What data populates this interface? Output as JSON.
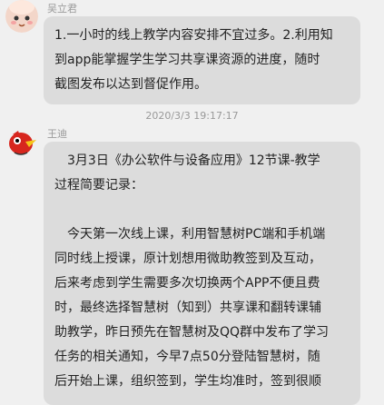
{
  "messages": [
    {
      "sender": "吴立君",
      "avatar_icon": "cartoon-face-avatar",
      "lines": [
        "1.一小时的线上教学内容安排不宜过多。2.利用知",
        "到app能掌握学生学习共享课资源的进度，随时",
        "截图发布以达到督促作用。"
      ]
    },
    {
      "timestamp": "2020/3/3 19:17:17",
      "sender": "王迪",
      "avatar_icon": "red-bird-avatar",
      "lines": [
        "　3月3日《办公软件与设备应用》12节课-教学",
        "过程简要记录：",
        "",
        "　今天第一次线上课，利用智慧树PC端和手机端",
        "同时线上授课，原计划想用微助教签到及互动，",
        "后来考虑到学生需要多次切换两个APP不便且费",
        "时，最终选择智慧树（知到）共享课和翻转课辅",
        "助教学，昨日预先在智慧树及QQ群中发布了学习",
        "任务的相关通知，今早7点50分登陆智慧树，随",
        "后开始上课，组织签到，学生均准时，签到很顺"
      ]
    }
  ],
  "colors": {
    "background": "#f0f0f0",
    "bubble": "#dcdcdc",
    "text": "#222222",
    "meta_text": "#9a9a9a"
  }
}
